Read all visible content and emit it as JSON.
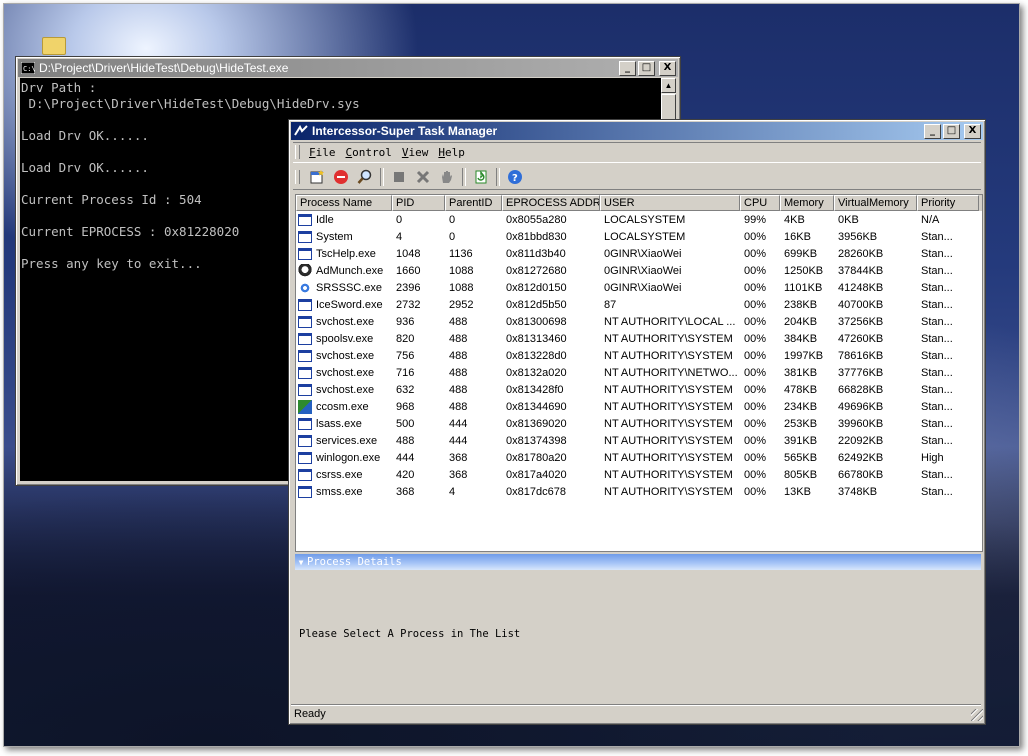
{
  "console": {
    "title": "D:\\Project\\Driver\\HideTest\\Debug\\HideTest.exe",
    "lines": [
      "Drv Path :",
      " D:\\Project\\Driver\\HideTest\\Debug\\HideDrv.sys",
      "",
      "Load Drv OK......",
      "",
      "Load Drv OK......",
      "",
      "Current Process Id : 504",
      "",
      "Current EPROCESS : 0x81228020",
      "",
      "Press any key to exit..."
    ],
    "buttons": {
      "minimize": "_",
      "maximize": "□",
      "close": "X"
    }
  },
  "taskmgr": {
    "title": "Intercessor-Super Task Manager",
    "menu": [
      {
        "accel": "F",
        "rest": "ile"
      },
      {
        "accel": "C",
        "rest": "ontrol"
      },
      {
        "accel": "V",
        "rest": "iew"
      },
      {
        "accel": "H",
        "rest": "elp"
      }
    ],
    "toolbar_icons": [
      "new-process-icon",
      "stop-icon",
      "find-icon",
      "suspend-icon",
      "kill-icon",
      "hand-icon",
      "refresh-icon",
      "help-icon"
    ],
    "columns": [
      "Process Name",
      "PID",
      "ParentID",
      "EPROCESS ADDR",
      "USER",
      "CPU",
      "Memory",
      "VirtualMemory",
      "Priority"
    ],
    "rows": [
      {
        "icon": "window",
        "name": "Idle",
        "pid": "0",
        "ppid": "0",
        "ep": "0x8055a280",
        "user": "LOCALSYSTEM",
        "cpu": "99%",
        "mem": "4KB",
        "vm": "0KB",
        "pri": "N/A"
      },
      {
        "icon": "window",
        "name": "System",
        "pid": "4",
        "ppid": "0",
        "ep": "0x81bbd830",
        "user": "LOCALSYSTEM",
        "cpu": "00%",
        "mem": "16KB",
        "vm": "3956KB",
        "pri": "Stan..."
      },
      {
        "icon": "window",
        "name": "TscHelp.exe",
        "pid": "1048",
        "ppid": "1136",
        "ep": "0x811d3b40",
        "user": "0GINR\\XiaoWei",
        "cpu": "00%",
        "mem": "699KB",
        "vm": "28260KB",
        "pri": "Stan..."
      },
      {
        "icon": "admunch",
        "name": "AdMunch.exe",
        "pid": "1660",
        "ppid": "1088",
        "ep": "0x81272680",
        "user": "0GINR\\XiaoWei",
        "cpu": "00%",
        "mem": "1250KB",
        "vm": "37844KB",
        "pri": "Stan..."
      },
      {
        "icon": "srs",
        "name": "SRSSSC.exe",
        "pid": "2396",
        "ppid": "1088",
        "ep": "0x812d0150",
        "user": "0GINR\\XiaoWei",
        "cpu": "00%",
        "mem": "1101KB",
        "vm": "41248KB",
        "pri": "Stan..."
      },
      {
        "icon": "window",
        "name": "IceSword.exe",
        "pid": "2732",
        "ppid": "2952",
        "ep": "0x812d5b50",
        "user": "87",
        "cpu": "00%",
        "mem": "238KB",
        "vm": "40700KB",
        "pri": "Stan..."
      },
      {
        "icon": "window",
        "name": "svchost.exe",
        "pid": "936",
        "ppid": "488",
        "ep": "0x81300698",
        "user": "NT AUTHORITY\\LOCAL ...",
        "cpu": "00%",
        "mem": "204KB",
        "vm": "37256KB",
        "pri": "Stan..."
      },
      {
        "icon": "window",
        "name": "spoolsv.exe",
        "pid": "820",
        "ppid": "488",
        "ep": "0x81313460",
        "user": "NT AUTHORITY\\SYSTEM",
        "cpu": "00%",
        "mem": "384KB",
        "vm": "47260KB",
        "pri": "Stan..."
      },
      {
        "icon": "window",
        "name": "svchost.exe",
        "pid": "756",
        "ppid": "488",
        "ep": "0x813228d0",
        "user": "NT AUTHORITY\\SYSTEM",
        "cpu": "00%",
        "mem": "1997KB",
        "vm": "78616KB",
        "pri": "Stan..."
      },
      {
        "icon": "window",
        "name": "svchost.exe",
        "pid": "716",
        "ppid": "488",
        "ep": "0x8132a020",
        "user": "NT AUTHORITY\\NETWO...",
        "cpu": "00%",
        "mem": "381KB",
        "vm": "37776KB",
        "pri": "Stan..."
      },
      {
        "icon": "window",
        "name": "svchost.exe",
        "pid": "632",
        "ppid": "488",
        "ep": "0x813428f0",
        "user": "NT AUTHORITY\\SYSTEM",
        "cpu": "00%",
        "mem": "478KB",
        "vm": "66828KB",
        "pri": "Stan..."
      },
      {
        "icon": "ccosm",
        "name": "ccosm.exe",
        "pid": "968",
        "ppid": "488",
        "ep": "0x81344690",
        "user": "NT AUTHORITY\\SYSTEM",
        "cpu": "00%",
        "mem": "234KB",
        "vm": "49696KB",
        "pri": "Stan..."
      },
      {
        "icon": "window",
        "name": "lsass.exe",
        "pid": "500",
        "ppid": "444",
        "ep": "0x81369020",
        "user": "NT AUTHORITY\\SYSTEM",
        "cpu": "00%",
        "mem": "253KB",
        "vm": "39960KB",
        "pri": "Stan..."
      },
      {
        "icon": "window",
        "name": "services.exe",
        "pid": "488",
        "ppid": "444",
        "ep": "0x81374398",
        "user": "NT AUTHORITY\\SYSTEM",
        "cpu": "00%",
        "mem": "391KB",
        "vm": "22092KB",
        "pri": "Stan..."
      },
      {
        "icon": "window",
        "name": "winlogon.exe",
        "pid": "444",
        "ppid": "368",
        "ep": "0x81780a20",
        "user": "NT AUTHORITY\\SYSTEM",
        "cpu": "00%",
        "mem": "565KB",
        "vm": "62492KB",
        "pri": "High"
      },
      {
        "icon": "window",
        "name": "csrss.exe",
        "pid": "420",
        "ppid": "368",
        "ep": "0x817a4020",
        "user": "NT AUTHORITY\\SYSTEM",
        "cpu": "00%",
        "mem": "805KB",
        "vm": "66780KB",
        "pri": "Stan..."
      },
      {
        "icon": "window",
        "name": "smss.exe",
        "pid": "368",
        "ppid": "4",
        "ep": "0x817dc678",
        "user": "NT AUTHORITY\\SYSTEM",
        "cpu": "00%",
        "mem": "13KB",
        "vm": "3748KB",
        "pri": "Stan..."
      }
    ],
    "details_label": "Process Details",
    "details_text": "Please Select A Process in The List",
    "status": "Ready",
    "colors": {
      "title_active": "#0a246a",
      "details_bar": "#6f9be8"
    }
  }
}
